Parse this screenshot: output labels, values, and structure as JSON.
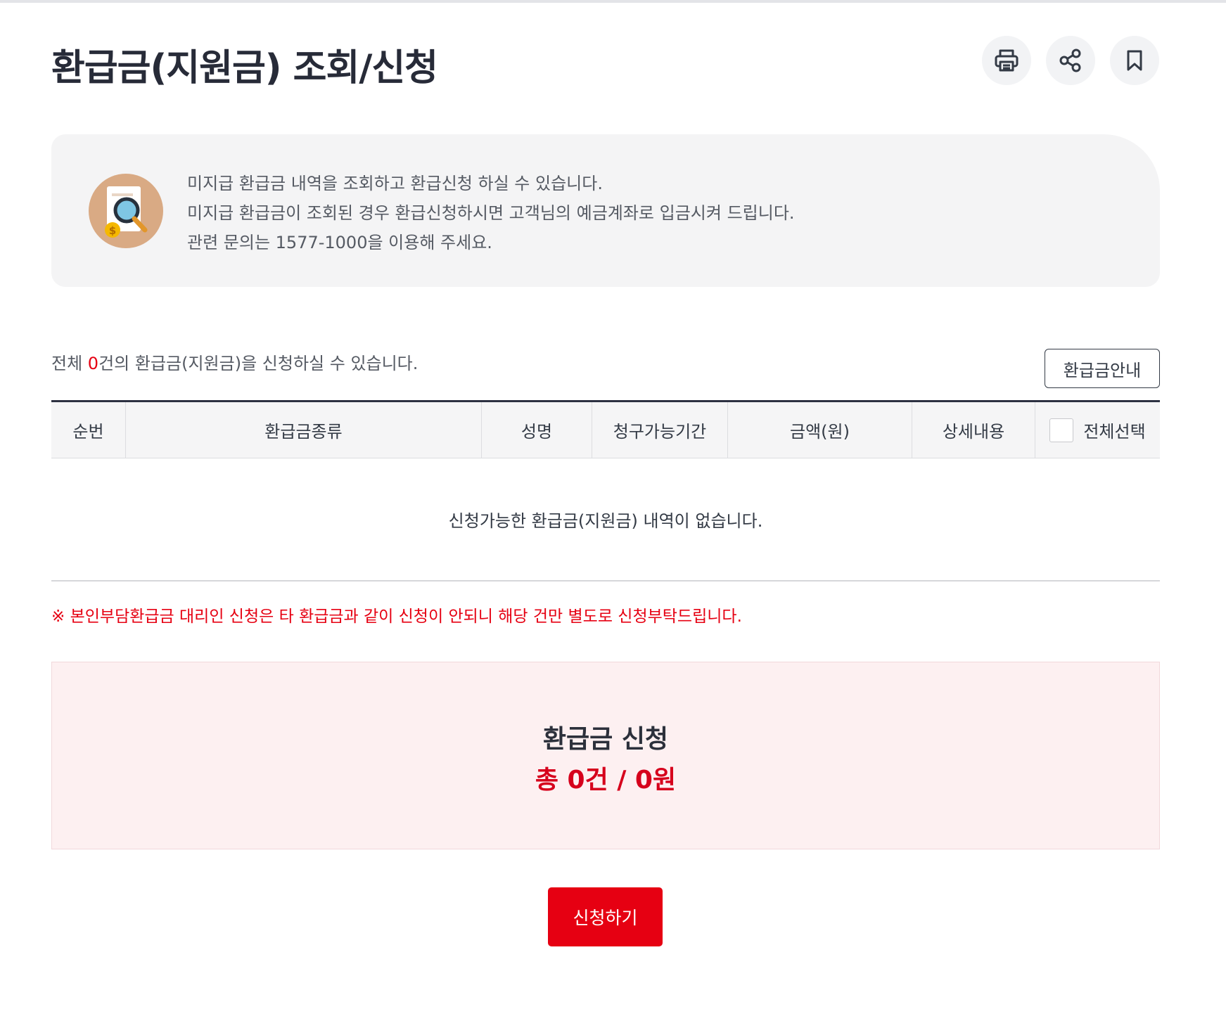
{
  "page": {
    "title": "환급금(지원금) 조회/신청"
  },
  "toolbar": {
    "print_icon": "print-icon",
    "share_icon": "share-icon",
    "bookmark_icon": "bookmark-icon"
  },
  "info": {
    "icon": "search-document-icon",
    "lines": [
      "미지급 환급금 내역을 조회하고 환급신청 하실 수 있습니다.",
      "미지급 환급금이 조회된 경우 환급신청하시면 고객님의 예금계좌로 입금시켜 드립니다.",
      "관련 문의는 1577-1000을 이용해 주세요."
    ]
  },
  "list": {
    "count_prefix": "전체 ",
    "count": "0",
    "count_suffix": "건의 환급금(지원금)을 신청하실 수 있습니다.",
    "guide_button": "환급금안내"
  },
  "table": {
    "columns": [
      "순번",
      "환급금종류",
      "성명",
      "청구가능기간",
      "금액(원)",
      "상세내용",
      "전체선택"
    ],
    "empty_message": "신청가능한 환급금(지원금) 내역이 없습니다."
  },
  "notice": "※ 본인부담환급금 대리인 신청은 타 환급금과 같이 신청이 안되니 해당 건만 별도로 신청부탁드립니다.",
  "summary": {
    "title": "환급금 신청",
    "total": "총 0건 / 0원"
  },
  "actions": {
    "apply_button": "신청하기"
  },
  "colors": {
    "accent_red": "#e60012",
    "title_dark": "#272b38",
    "summary_bg": "#fdf0f1"
  }
}
